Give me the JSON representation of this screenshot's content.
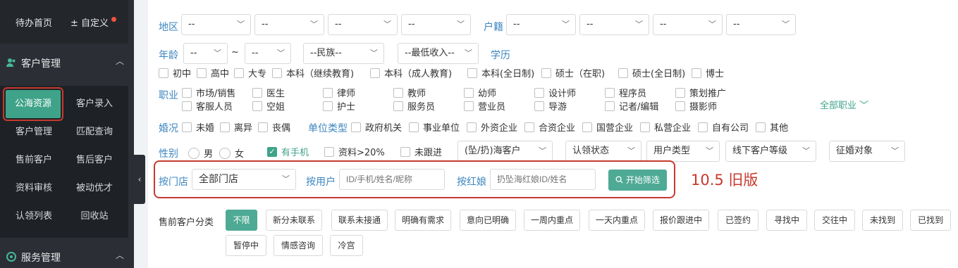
{
  "sidebar": {
    "home": "待办首页",
    "custom": "自定义",
    "groups": [
      {
        "label": "客户管理"
      },
      {
        "label": "服务管理"
      }
    ],
    "items": [
      "公海资源",
      "客户录入",
      "客户管理",
      "匹配查询",
      "售前客户",
      "售后客户",
      "资料审核",
      "被动优才",
      "认领列表",
      "回收站"
    ]
  },
  "filters": {
    "region_label": "地区",
    "region_values": [
      "--",
      "--",
      "--",
      "--"
    ],
    "hukou_label": "户籍",
    "hukou_values": [
      "--",
      "--",
      "--",
      "--"
    ],
    "age_label": "年龄",
    "age_from": "--",
    "age_sep": "~",
    "age_to": "--",
    "ethnicity": "--民族--",
    "income": "--最低收入--",
    "education_label": "学历",
    "education_options": [
      "初中",
      "高中",
      "大专",
      "本科（继续教育)",
      "本科（成人教育)",
      "本科(全日制)",
      "硕士（在职)",
      "硕士(全日制)",
      "博士"
    ],
    "job_label": "职业",
    "job_options_row1": [
      "市场/销售",
      "医生",
      "律师",
      "教师",
      "幼师",
      "设计师",
      "程序员",
      "策划推广"
    ],
    "job_options_row2": [
      "客服人员",
      "空姐",
      "护士",
      "服务员",
      "营业员",
      "导游",
      "记者/编辑",
      "摄影师"
    ],
    "all_jobs": "全部职业",
    "marital_label": "婚况",
    "marital_options": [
      "未婚",
      "离异",
      "丧偶"
    ],
    "employer_label": "单位类型",
    "employer_options": [
      "政府机关",
      "事业单位",
      "外资企业",
      "合资企业",
      "国营企业",
      "私营企业",
      "自有公司",
      "其他"
    ],
    "gender_label": "性别",
    "gender_options": [
      "男",
      "女"
    ],
    "has_phone": "有手机",
    "profile_complete": "资料>20%",
    "not_followed": "未跟进",
    "sea_customer": "(坠/扔)海客户",
    "claim_status": "认领状态",
    "user_type": "用户类型",
    "offline_level": "线下客户等级",
    "marriage_target": "征婚对象"
  },
  "search": {
    "store_label": "按门店",
    "store_value": "全部门店",
    "user_label": "按用户",
    "user_placeholder": "ID/手机/姓名/昵称",
    "matchmaker_label": "按红娘",
    "matchmaker_placeholder": "扔坠海红娘ID/姓名",
    "start_button": "开始筛选"
  },
  "annotation": "10.5 旧版",
  "categories": {
    "label": "售前客户分类",
    "chips": [
      "不限",
      "新分未联系",
      "联系未接通",
      "明确有需求",
      "意向已明确",
      "一周内重点",
      "一天内重点",
      "报价跟进中",
      "已签约",
      "寻找中",
      "交往中",
      "未找到",
      "已找到",
      "暂停中",
      "情感咨询",
      "冷宫"
    ],
    "active_index": 0
  }
}
